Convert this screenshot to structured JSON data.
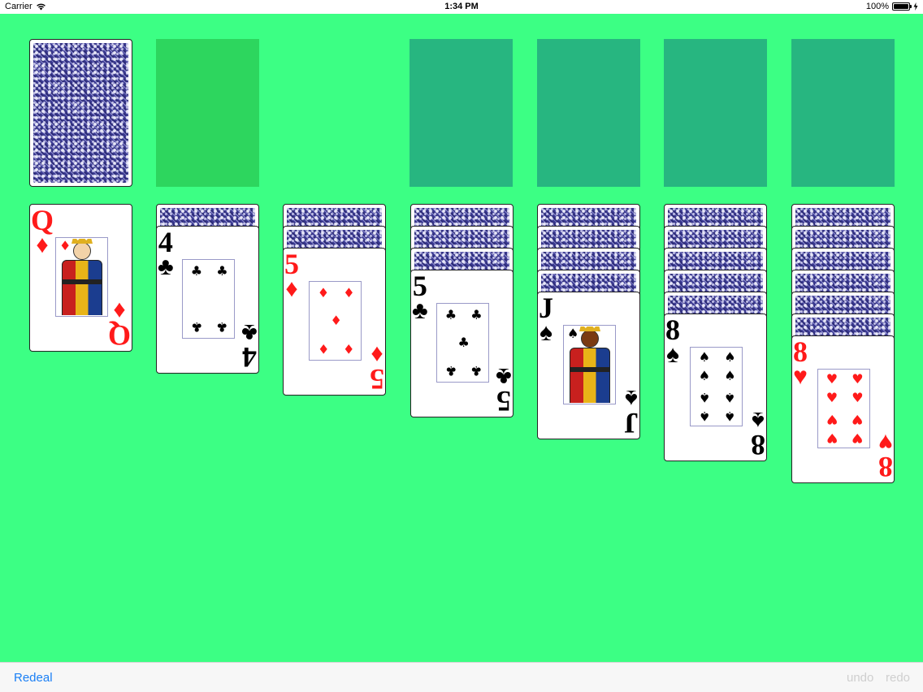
{
  "status_bar": {
    "carrier": "Carrier",
    "time": "1:34 PM",
    "battery": "100%",
    "battery_level": 1.0
  },
  "colors": {
    "felt": "#3cff84",
    "waste_slot": "#2dd65e",
    "foundation_slot": "#27b680",
    "red_suit": "#ff1a1a",
    "link_blue": "#1a7ff5",
    "disabled_gray": "#cfcfcf"
  },
  "stock": {
    "face_down": true
  },
  "waste": {
    "empty": true
  },
  "foundations": [
    {
      "empty": true
    },
    {
      "empty": true
    },
    {
      "empty": true
    },
    {
      "empty": true
    }
  ],
  "tableau": [
    {
      "hidden": 0,
      "top": {
        "rank": "Q",
        "suit": "♦",
        "color": "red",
        "court": true
      }
    },
    {
      "hidden": 1,
      "top": {
        "rank": "4",
        "suit": "♣",
        "color": "black"
      }
    },
    {
      "hidden": 2,
      "top": {
        "rank": "5",
        "suit": "♦",
        "color": "red"
      }
    },
    {
      "hidden": 3,
      "top": {
        "rank": "5",
        "suit": "♣",
        "color": "black"
      }
    },
    {
      "hidden": 4,
      "top": {
        "rank": "J",
        "suit": "♠",
        "color": "black",
        "court": true
      }
    },
    {
      "hidden": 5,
      "top": {
        "rank": "8",
        "suit": "♠",
        "color": "black"
      }
    },
    {
      "hidden": 6,
      "top": {
        "rank": "8",
        "suit": "♥",
        "color": "red"
      }
    }
  ],
  "toolbar": {
    "redeal": "Redeal",
    "undo": "undo",
    "redo": "redo",
    "undo_enabled": false,
    "redo_enabled": false
  }
}
